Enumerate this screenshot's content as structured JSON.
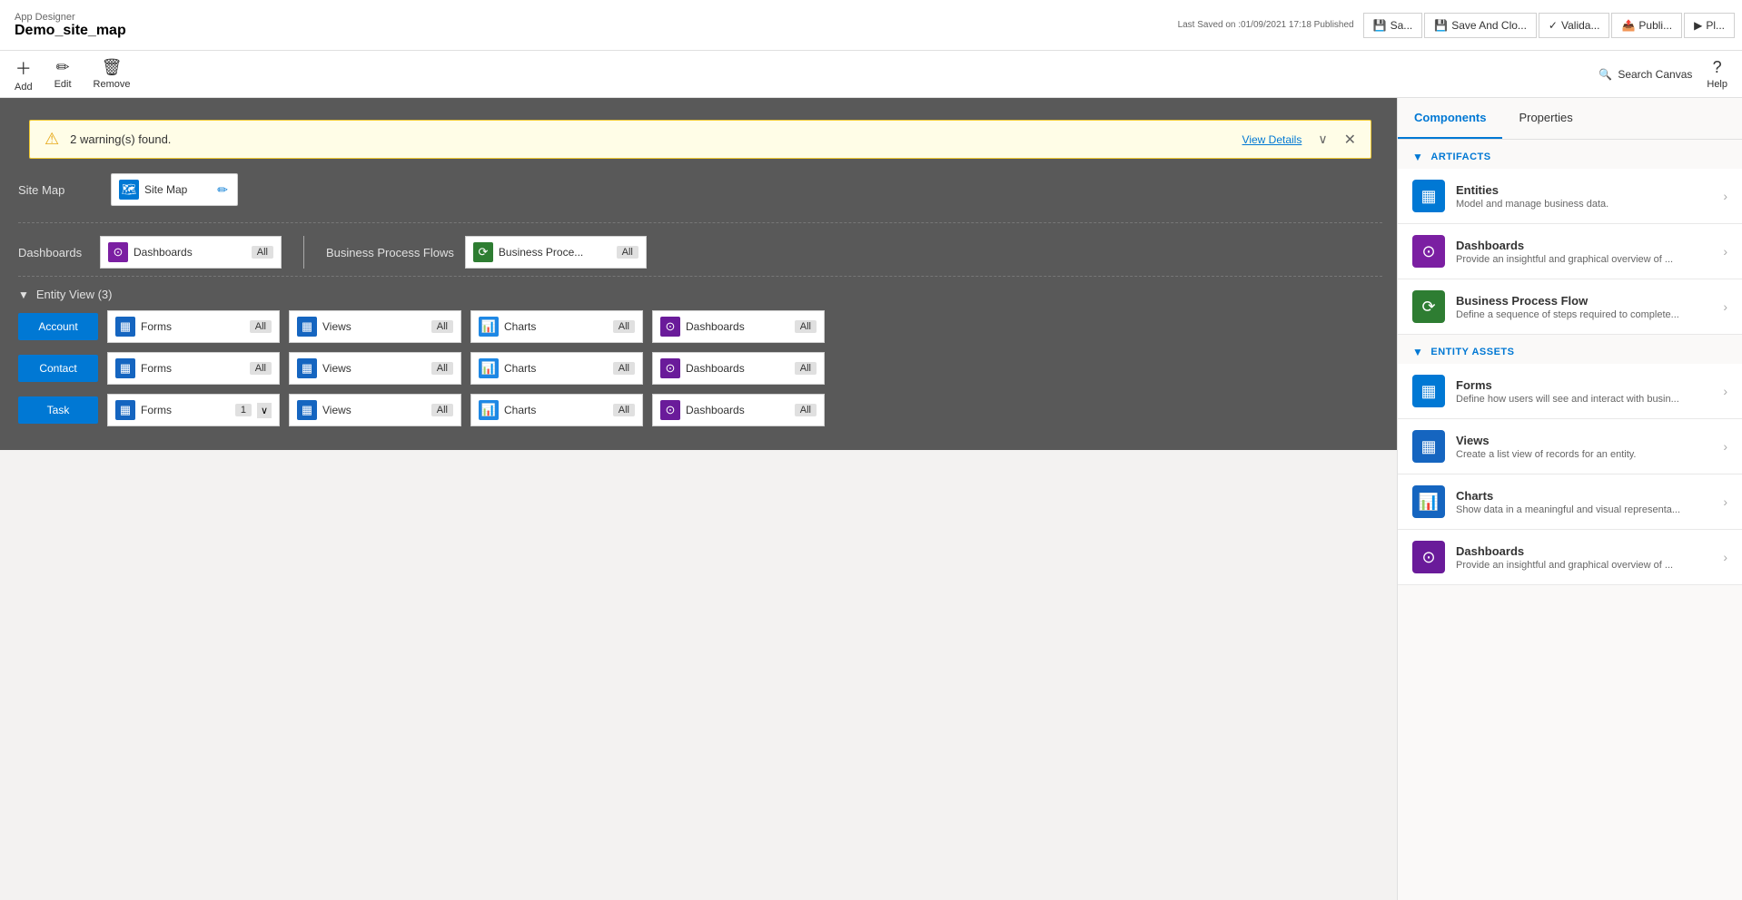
{
  "header": {
    "app_designer": "App Designer",
    "app_name": "Demo_site_map",
    "save_info": "Last Saved on :01/09/2021 17:18 Published",
    "buttons": [
      {
        "label": "Sa...",
        "id": "save"
      },
      {
        "label": "Save And Clo...",
        "id": "save_close"
      },
      {
        "label": "Valida...",
        "id": "validate"
      },
      {
        "label": "Publi...",
        "id": "publish"
      },
      {
        "label": "Pl...",
        "id": "play"
      }
    ]
  },
  "toolbar": {
    "add_label": "Add",
    "edit_label": "Edit",
    "remove_label": "Remove",
    "search_canvas_label": "Search Canvas",
    "help_label": "Help"
  },
  "warning": {
    "text": "2 warning(s) found.",
    "view_details": "View Details"
  },
  "canvas": {
    "site_map_section": {
      "label": "Site Map",
      "node_label": "Site Map",
      "node_icon": "🗺"
    },
    "dashboards_row": {
      "label": "Dashboards",
      "dashboards_node": {
        "label": "Dashboards",
        "badge": "All",
        "icon": "⊙"
      },
      "bpf_label": "Business Process Flows",
      "bpf_node": {
        "label": "Business Proce...",
        "badge": "All",
        "icon": "⟳"
      }
    },
    "entity_view": {
      "header": "Entity View (3)",
      "entities": [
        {
          "name": "Account",
          "forms": {
            "label": "Forms",
            "badge": "All"
          },
          "views": {
            "label": "Views",
            "badge": "All"
          },
          "charts": {
            "label": "Charts",
            "badge": "All"
          },
          "dashboards": {
            "label": "Dashboards",
            "badge": "All"
          }
        },
        {
          "name": "Contact",
          "forms": {
            "label": "Forms",
            "badge": "All"
          },
          "views": {
            "label": "Views",
            "badge": "All"
          },
          "charts": {
            "label": "Charts",
            "badge": "All"
          },
          "dashboards": {
            "label": "Dashboards",
            "badge": "All"
          }
        },
        {
          "name": "Task",
          "forms": {
            "label": "Forms",
            "badge": "1"
          },
          "views": {
            "label": "Views",
            "badge": "All"
          },
          "charts": {
            "label": "Charts",
            "badge": "All"
          },
          "dashboards": {
            "label": "Dashboards",
            "badge": "All"
          }
        }
      ]
    }
  },
  "right_panel": {
    "components_tab": "Components",
    "properties_tab": "Properties",
    "artifacts_header": "ARTIFACTS",
    "entity_assets_header": "ENTITY ASSETS",
    "components": [
      {
        "id": "entities",
        "name": "Entities",
        "desc": "Model and manage business data.",
        "icon_type": "ci-blue",
        "icon": "▦"
      },
      {
        "id": "dashboards",
        "name": "Dashboards",
        "desc": "Provide an insightful and graphical overview of ...",
        "icon_type": "ci-purple",
        "icon": "⊙"
      },
      {
        "id": "bpf",
        "name": "Business Process Flow",
        "desc": "Define a sequence of steps required to complete...",
        "icon_type": "ci-green",
        "icon": "⟳"
      }
    ],
    "entity_assets": [
      {
        "id": "forms",
        "name": "Forms",
        "desc": "Define how users will see and interact with busin...",
        "icon_type": "ci-blue",
        "icon": "▦"
      },
      {
        "id": "views",
        "name": "Views",
        "desc": "Create a list view of records for an entity.",
        "icon_type": "ci-views",
        "icon": "▦"
      },
      {
        "id": "charts",
        "name": "Charts",
        "desc": "Show data in a meaningful and visual representa...",
        "icon_type": "ci-chart",
        "icon": "📊"
      },
      {
        "id": "dashboards2",
        "name": "Dashboards",
        "desc": "Provide an insightful and graphical overview of ...",
        "icon_type": "ci-dash",
        "icon": "⊙"
      }
    ]
  }
}
